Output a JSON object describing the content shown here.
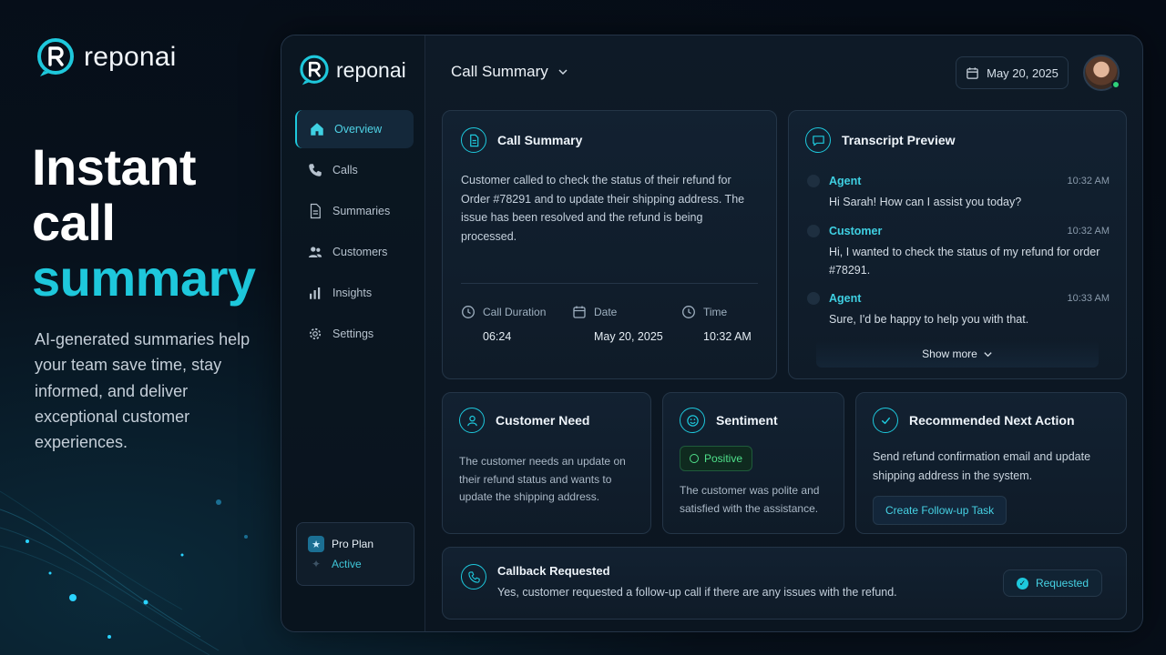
{
  "hero": {
    "brand": "reponai",
    "title_line1": "Instant",
    "title_line2": "call",
    "title_accent": "summary",
    "description": "AI-generated summaries help your team save time, stay informed, and deliver exceptional customer experiences."
  },
  "sidebar": {
    "brand": "reponai",
    "items": [
      {
        "label": "Overview",
        "icon": "home-icon",
        "active": true
      },
      {
        "label": "Calls",
        "icon": "phone-icon"
      },
      {
        "label": "Summaries",
        "icon": "document-icon"
      },
      {
        "label": "Customers",
        "icon": "users-icon"
      },
      {
        "label": "Insights",
        "icon": "bar-chart-icon"
      },
      {
        "label": "Settings",
        "icon": "gear-icon"
      }
    ],
    "plan": {
      "name": "Pro Plan",
      "status": "Active"
    }
  },
  "header": {
    "title": "Call Summary",
    "date": "May 20, 2025"
  },
  "summary": {
    "title": "Call Summary",
    "text": "Customer called to check the status of their refund for Order #78291 and to update their shipping address. The issue has been resolved and the refund is being processed.",
    "duration_label": "Call Duration",
    "duration": "06:24",
    "date_label": "Date",
    "date": "May 20, 2025",
    "time_label": "Time",
    "time": "10:32 AM"
  },
  "transcript": {
    "title": "Transcript Preview",
    "messages": [
      {
        "speaker": "Agent",
        "time": "10:32 AM",
        "text": "Hi Sarah! How can I assist you today?"
      },
      {
        "speaker": "Customer",
        "time": "10:32 AM",
        "text": "Hi, I wanted to check the status of my refund for order #78291."
      },
      {
        "speaker": "Agent",
        "time": "10:33 AM",
        "text": "Sure, I'd be happy to help you with that."
      }
    ],
    "show_more": "Show more"
  },
  "need": {
    "title": "Customer Need",
    "text": "The customer needs an update on their refund status and wants to update the shipping address."
  },
  "sentiment": {
    "title": "Sentiment",
    "badge": "Positive",
    "text": "The customer was polite and satisfied with the assistance."
  },
  "next_action": {
    "title": "Recommended Next Action",
    "text": "Send refund confirmation email and update shipping address in the system.",
    "button": "Create Follow-up Task"
  },
  "callback": {
    "title": "Callback Requested",
    "text": "Yes, customer requested a follow-up call if there are any issues with the refund.",
    "badge": "Requested"
  },
  "colors": {
    "accent": "#1ec8dc",
    "positive": "#4fe08a",
    "background": "#07111c"
  }
}
